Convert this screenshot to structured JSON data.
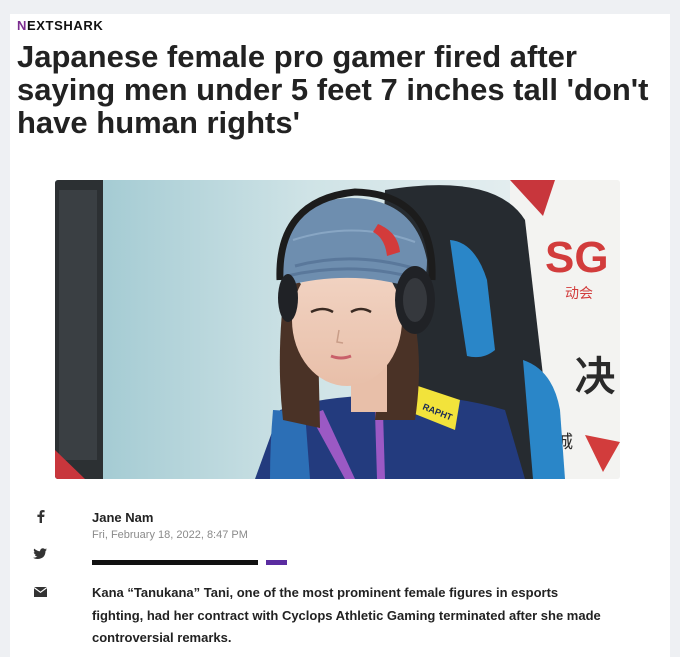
{
  "brand": {
    "logo_first": "N",
    "logo_rest": "EXTSHARK"
  },
  "article": {
    "title": "Japanese female pro gamer fired after saying men under 5 feet 7 inches tall 'don't have human rights'",
    "author": "Jane Nam",
    "date": "Fri, February 18, 2022, 8:47 PM",
    "lede": "Kana “Tanukana” Tani, one of the most prominent female figures in esports fighting, had her contract with Cyclops Athletic Gaming terminated after she made controversial remarks."
  },
  "hero_image": {
    "banner_text": "SG",
    "sub_text": "动会",
    "side_char": "决",
    "side_char2": "城",
    "jersey_text": "RAPHT"
  },
  "share": {
    "icons": [
      "facebook-icon",
      "twitter-icon",
      "email-icon"
    ]
  },
  "colors": {
    "brand_purple": "#7b2d8f",
    "divider_purple": "#5a2ca0",
    "divider_black": "#111111"
  }
}
